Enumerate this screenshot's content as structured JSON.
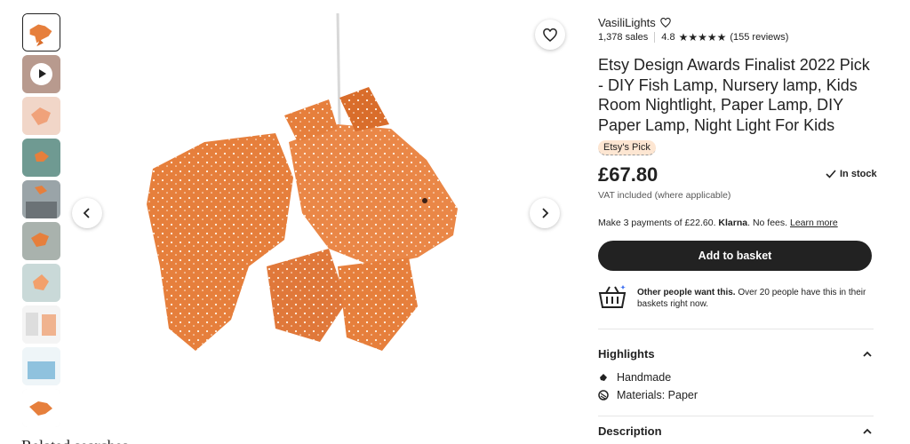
{
  "gallery": {
    "thumbnails": [
      {
        "kind": "photo",
        "alt": "goldfish lamp"
      },
      {
        "kind": "video"
      },
      {
        "kind": "photo"
      },
      {
        "kind": "photo"
      },
      {
        "kind": "photo"
      },
      {
        "kind": "photo"
      },
      {
        "kind": "photo"
      },
      {
        "kind": "photo"
      },
      {
        "kind": "photo"
      },
      {
        "kind": "photo"
      }
    ],
    "prev_icon": "chevron-left-icon",
    "next_icon": "chevron-right-icon",
    "favorite_icon": "heart-icon",
    "below_heading": "Related searches"
  },
  "shop": {
    "name": "VasiliLights",
    "sales": "1,378 sales",
    "rating": "4.8",
    "stars": "★★★★★",
    "reviews": "(155 reviews)"
  },
  "listing": {
    "title": "Etsy Design Awards Finalist 2022 Pick - DIY Fish Lamp, Nursery lamp, Kids Room Nightlight, Paper Lamp, DIY Paper Lamp, Night Light For Kids",
    "badge": "Etsy's Pick",
    "price": "£67.80",
    "stock": "In stock",
    "vat": "VAT included (where applicable)",
    "klarna_prefix": "Make 3 payments of £22.60.",
    "klarna_brand": "Klarna",
    "klarna_suffix": ". No fees.",
    "klarna_link": "Learn more",
    "add_to_basket": "Add to basket",
    "demand_bold": "Other people want this.",
    "demand_rest": " Over 20 people have this in their baskets right now."
  },
  "highlights": {
    "heading": "Highlights",
    "items": [
      "Handmade",
      "Materials: Paper"
    ]
  },
  "description": {
    "heading": "Description"
  },
  "colors": {
    "fish": "#e67f3c",
    "button": "#222222",
    "badge_bg": "#fde6d2"
  }
}
